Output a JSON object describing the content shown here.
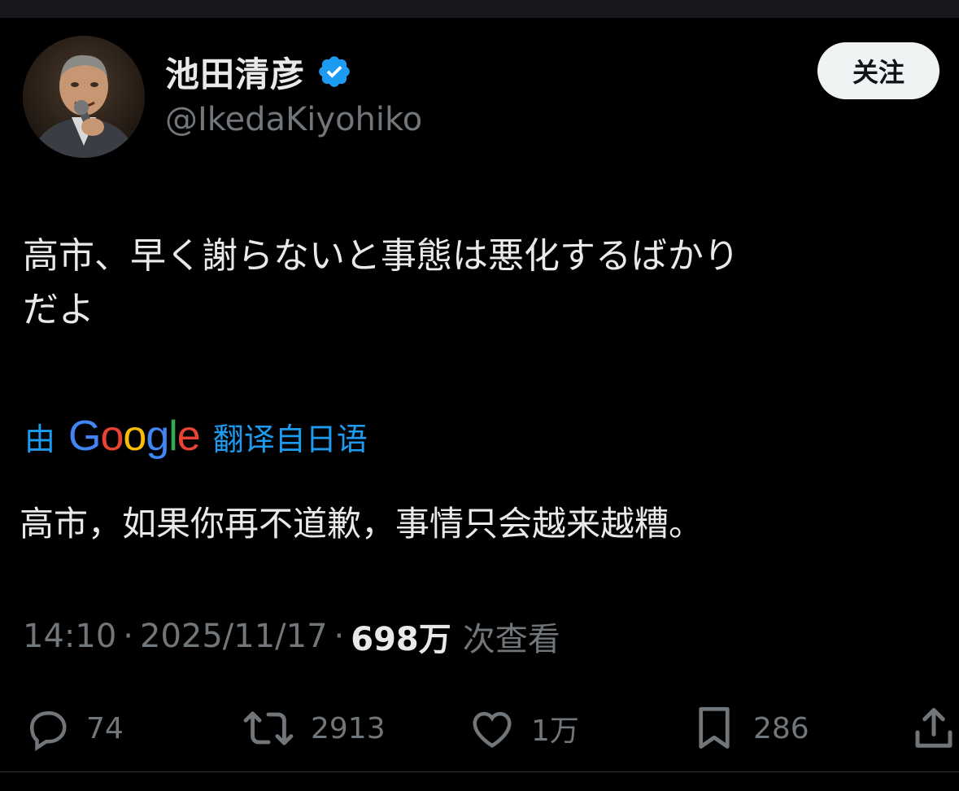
{
  "profile": {
    "display_name": "池田清彦",
    "handle": "@IkedaKiyohiko",
    "follow_label": "关注"
  },
  "tweet": {
    "text_line1": "高市、早く謝らないと事態は悪化するばかり",
    "text_line2": "だよ",
    "translate_prefix": "由",
    "translate_brand": [
      "G",
      "o",
      "o",
      "g",
      "l",
      "e"
    ],
    "translate_suffix": "翻译自日语",
    "translated_text": "高市，如果你再不道歉，事情只会越来越糟。",
    "time": "14:10",
    "date": "2025/11/17",
    "separator": "·",
    "views_count": "698万",
    "views_label": "次查看"
  },
  "actions": {
    "replies": "74",
    "reposts": "2913",
    "likes": "1万",
    "bookmarks": "286"
  },
  "colors": {
    "background": "#000000",
    "text": "#e7e9ea",
    "muted": "#71767b",
    "accent": "#1d9bf0",
    "verified": "#1d9bf0"
  },
  "icons": [
    "verified-badge-icon",
    "reply-icon",
    "repost-icon",
    "like-icon",
    "bookmark-icon",
    "share-icon"
  ]
}
